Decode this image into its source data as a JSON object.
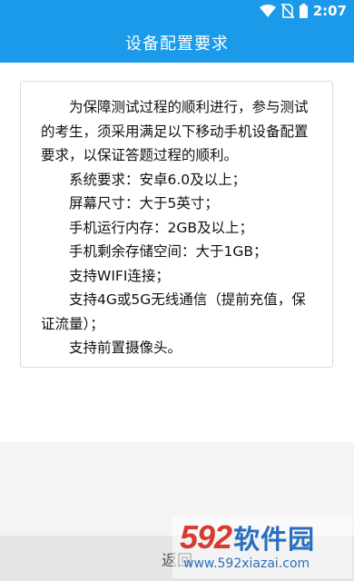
{
  "status_bar": {
    "time": "2:07",
    "icons": [
      "wifi-icon",
      "no-sim-icon",
      "battery-icon"
    ]
  },
  "header": {
    "title": "设备配置要求"
  },
  "card": {
    "intro": "为保障测试过程的顺利进行，参与测试的考生，须采用满足以下移动手机设备配置要求，以保证答题过程的顺利。",
    "requirements": [
      "系统要求：安卓6.0及以上；",
      "屏幕尺寸：大于5英寸；",
      "手机运行内存：2GB及以上；",
      "手机剩余存储空间：大于1GB；",
      "支持WIFI连接；",
      "支持4G或5G无线通信（提前充值，保证流量）；",
      "支持前置摄像头。"
    ]
  },
  "footer": {
    "back_label": "返回"
  },
  "watermark": {
    "number": "592",
    "brand": "软件园",
    "url": "www.592xiazai.com"
  },
  "colors": {
    "primary": "#1a9ae8",
    "watermark_red": "#d93a30",
    "watermark_blue": "#2a6fbe"
  }
}
